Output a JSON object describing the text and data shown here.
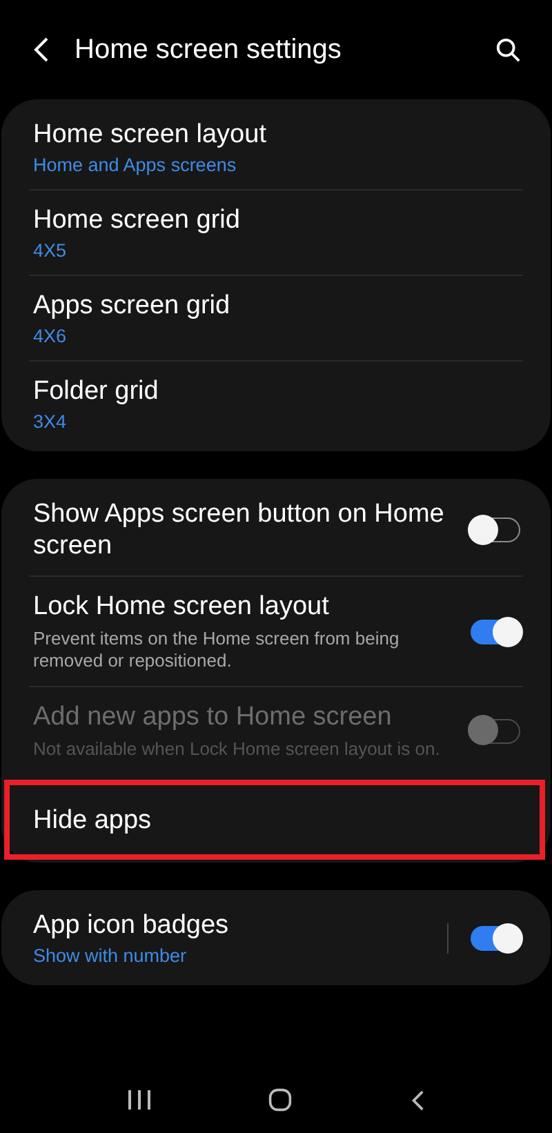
{
  "header": {
    "title": "Home screen settings"
  },
  "groups": [
    {
      "items": [
        {
          "kind": "link",
          "title": "Home screen layout",
          "subtitle": "Home and Apps screens"
        },
        {
          "kind": "link",
          "title": "Home screen grid",
          "subtitle": "4X5"
        },
        {
          "kind": "link",
          "title": "Apps screen grid",
          "subtitle": "4X6"
        },
        {
          "kind": "link",
          "title": "Folder grid",
          "subtitle": "3X4"
        }
      ]
    },
    {
      "items": [
        {
          "kind": "toggle",
          "title": "Show Apps screen button on Home screen",
          "on": false,
          "disabled": false
        },
        {
          "kind": "toggle",
          "title": "Lock Home screen layout",
          "description": "Prevent items on the Home screen from being removed or repositioned.",
          "on": true,
          "disabled": false
        },
        {
          "kind": "toggle",
          "title": "Add new apps to Home screen",
          "description": "Not available when Lock Home screen layout is on.",
          "on": false,
          "disabled": true
        },
        {
          "kind": "link",
          "title": "Hide apps",
          "highlighted": true
        }
      ]
    },
    {
      "items": [
        {
          "kind": "split-toggle",
          "title": "App icon badges",
          "subtitle": "Show with number",
          "on": true,
          "disabled": false
        }
      ]
    }
  ]
}
